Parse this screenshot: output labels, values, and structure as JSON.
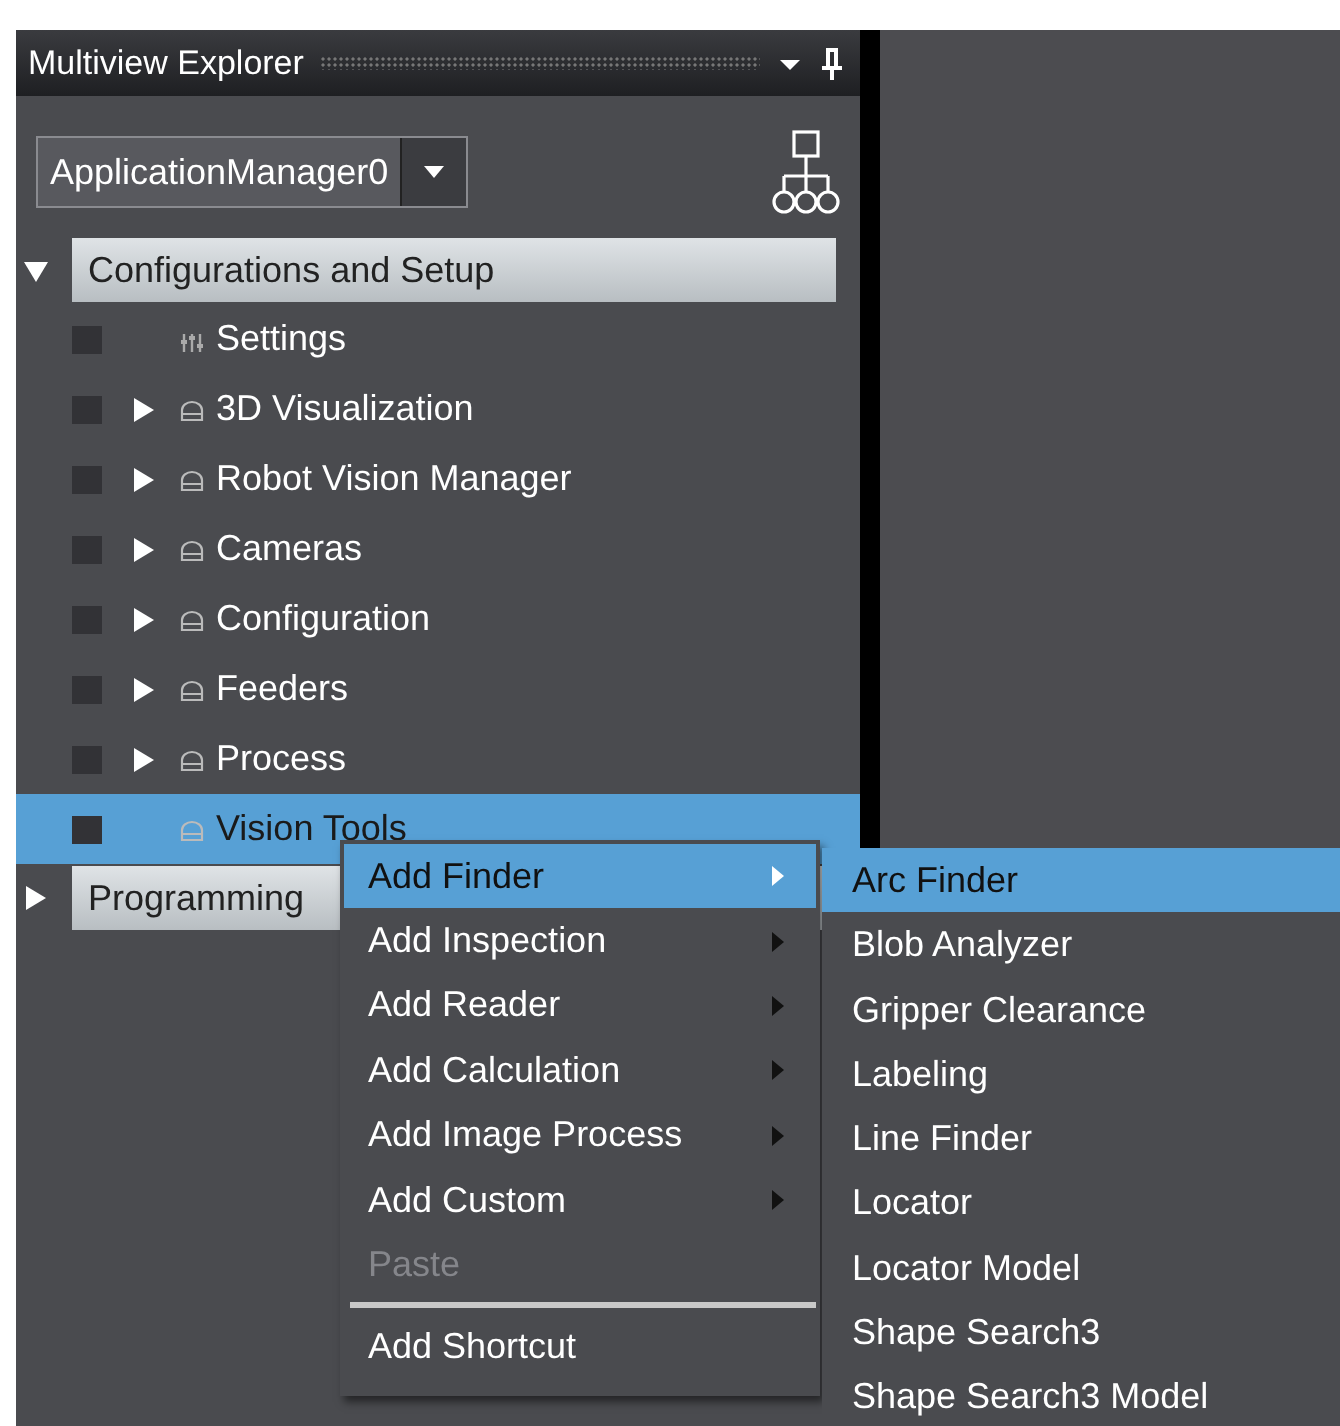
{
  "panel": {
    "title": "Multiview Explorer",
    "dropdown": {
      "value": "ApplicationManager0"
    }
  },
  "tree": [
    {
      "label": "Configurations and Setup",
      "expanded": true,
      "children": [
        {
          "label": "Settings",
          "kind": "settings",
          "has_children": false,
          "selected": false
        },
        {
          "label": "3D Visualization",
          "kind": "folder",
          "has_children": true,
          "selected": false
        },
        {
          "label": "Robot Vision Manager",
          "kind": "folder",
          "has_children": true,
          "selected": false
        },
        {
          "label": "Cameras",
          "kind": "folder",
          "has_children": true,
          "selected": false
        },
        {
          "label": "Configuration",
          "kind": "folder",
          "has_children": true,
          "selected": false
        },
        {
          "label": "Feeders",
          "kind": "folder",
          "has_children": true,
          "selected": false
        },
        {
          "label": "Process",
          "kind": "folder",
          "has_children": true,
          "selected": false
        },
        {
          "label": "Vision Tools",
          "kind": "folder",
          "has_children": false,
          "selected": true
        }
      ]
    },
    {
      "label": "Programming",
      "expanded": false
    }
  ],
  "context_menu": [
    {
      "kind": "item",
      "label": "Add Finder",
      "submenu": true,
      "selected": true,
      "disabled": false
    },
    {
      "kind": "item",
      "label": "Add Inspection",
      "submenu": true,
      "selected": false,
      "disabled": false
    },
    {
      "kind": "item",
      "label": "Add Reader",
      "submenu": true,
      "selected": false,
      "disabled": false
    },
    {
      "kind": "item",
      "label": "Add Calculation",
      "submenu": true,
      "selected": false,
      "disabled": false
    },
    {
      "kind": "item",
      "label": "Add Image Process",
      "submenu": true,
      "selected": false,
      "disabled": false
    },
    {
      "kind": "item",
      "label": "Add Custom",
      "submenu": true,
      "selected": false,
      "disabled": false
    },
    {
      "kind": "item",
      "label": "Paste",
      "submenu": false,
      "selected": false,
      "disabled": true
    },
    {
      "kind": "separator"
    },
    {
      "kind": "item",
      "label": "Add Shortcut",
      "submenu": false,
      "selected": false,
      "disabled": false
    }
  ],
  "submenu": [
    {
      "label": "Arc Finder",
      "selected": true
    },
    {
      "label": "Blob Analyzer",
      "selected": false
    },
    {
      "label": "Gripper Clearance",
      "selected": false
    },
    {
      "label": "Labeling",
      "selected": false
    },
    {
      "label": "Line Finder",
      "selected": false
    },
    {
      "label": "Locator",
      "selected": false
    },
    {
      "label": "Locator Model",
      "selected": false
    },
    {
      "label": "Shape Search3",
      "selected": false
    },
    {
      "label": "Shape Search3 Model",
      "selected": false
    }
  ]
}
